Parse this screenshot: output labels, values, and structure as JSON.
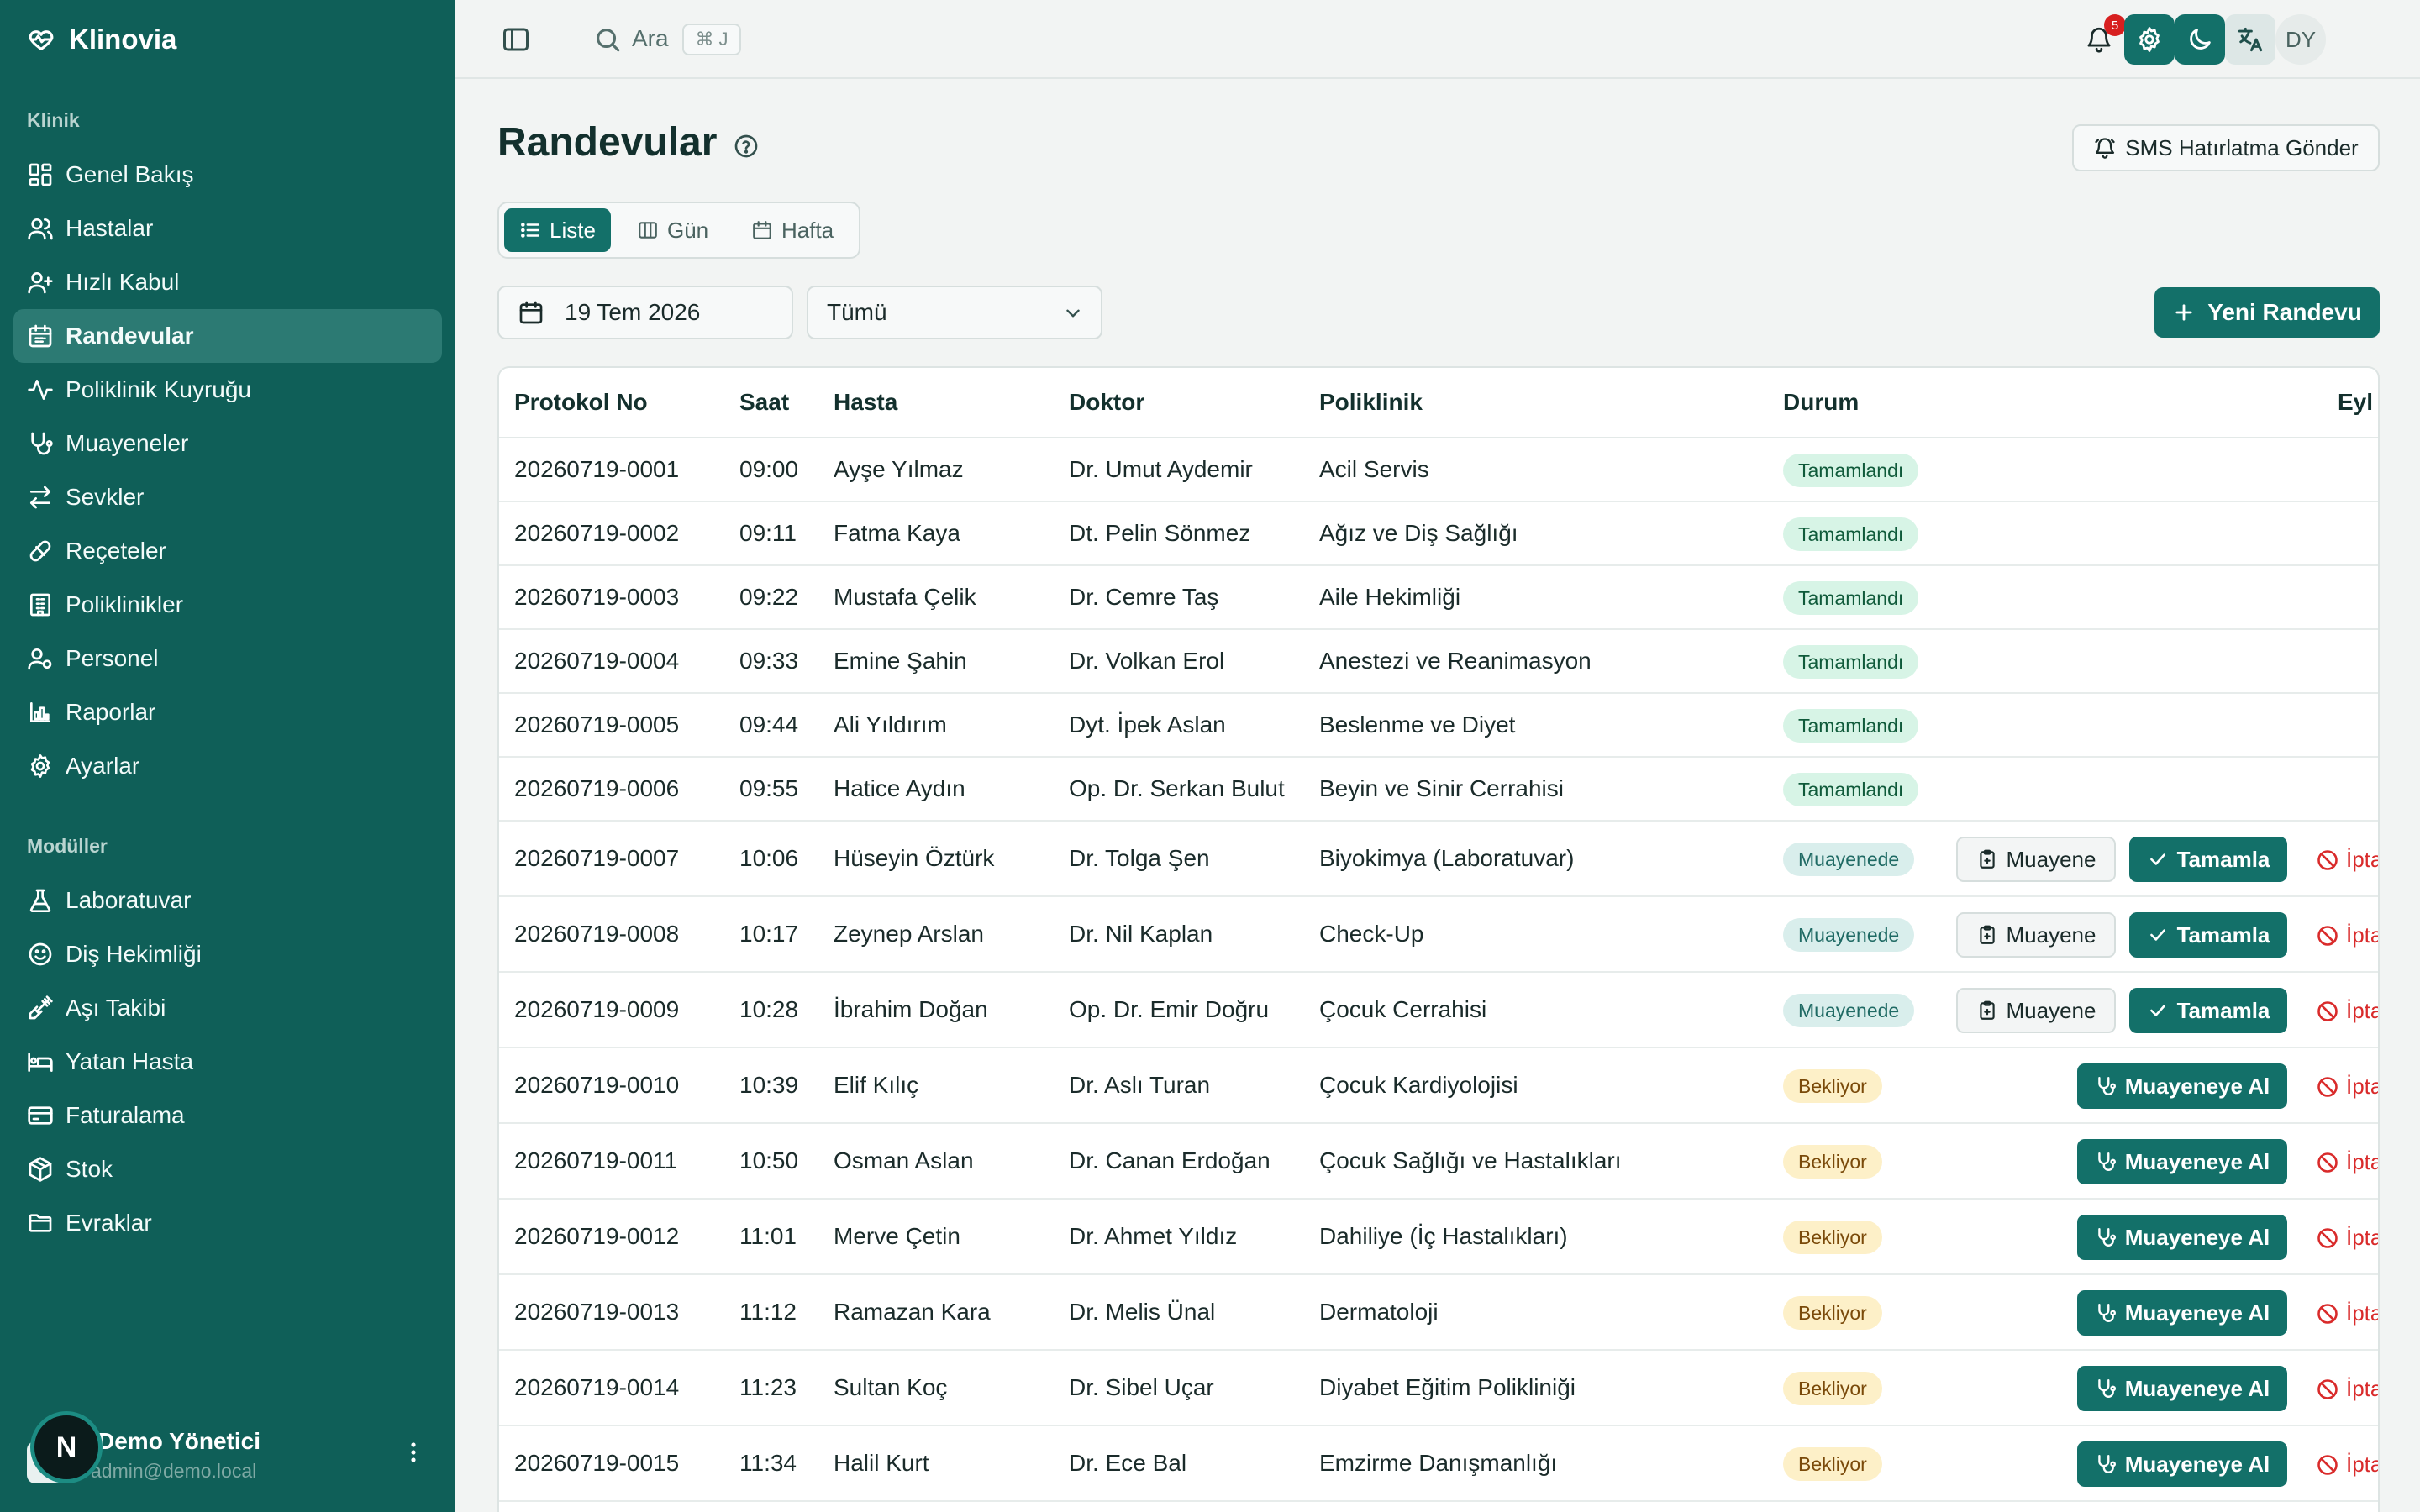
{
  "app": {
    "name": "Klinovia"
  },
  "sidebar": {
    "section1": "Klinik",
    "section2": "Modüller",
    "items": [
      {
        "label": "Genel Bakış",
        "icon": "dashboard-icon"
      },
      {
        "label": "Hastalar",
        "icon": "users-icon"
      },
      {
        "label": "Hızlı Kabul",
        "icon": "user-plus-icon"
      },
      {
        "label": "Randevular",
        "icon": "calendar-icon",
        "active": true
      },
      {
        "label": "Poliklinik Kuyruğu",
        "icon": "activity-icon"
      },
      {
        "label": "Muayeneler",
        "icon": "stethoscope-icon"
      },
      {
        "label": "Sevkler",
        "icon": "transfer-icon"
      },
      {
        "label": "Reçeteler",
        "icon": "pill-icon"
      },
      {
        "label": "Poliklinikler",
        "icon": "building-icon"
      },
      {
        "label": "Personel",
        "icon": "staff-icon"
      },
      {
        "label": "Raporlar",
        "icon": "bar-chart-icon"
      },
      {
        "label": "Ayarlar",
        "icon": "gear-icon"
      }
    ],
    "modules": [
      {
        "label": "Laboratuvar",
        "icon": "flask-icon"
      },
      {
        "label": "Diş Hekimliği",
        "icon": "smile-icon"
      },
      {
        "label": "Aşı Takibi",
        "icon": "syringe-icon"
      },
      {
        "label": "Yatan Hasta",
        "icon": "bed-icon"
      },
      {
        "label": "Faturalama",
        "icon": "credit-card-icon"
      },
      {
        "label": "Stok",
        "icon": "package-icon"
      },
      {
        "label": "Evraklar",
        "icon": "folder-icon"
      }
    ],
    "user": {
      "initial": "N",
      "name": "Demo Yönetici",
      "email": "admin@demo.local"
    }
  },
  "header": {
    "search_label": "Ara",
    "search_shortcut": "⌘ J",
    "notification_count": "5",
    "avatar_initials": "DY"
  },
  "main": {
    "title": "Randevular",
    "sms_button": "SMS Hatırlatma Gönder",
    "tabs": [
      {
        "label": "Liste",
        "active": true
      },
      {
        "label": "Gün"
      },
      {
        "label": "Hafta"
      }
    ],
    "date_value": "19 Tem 2026",
    "filter_value": "Tümü",
    "new_button": "Yeni Randevu"
  },
  "table": {
    "columns": [
      "Protokol No",
      "Saat",
      "Hasta",
      "Doktor",
      "Poliklinik",
      "Durum",
      "Eyl"
    ],
    "action_labels": {
      "examine": "Muayene",
      "complete": "Tamamla",
      "take_exam": "Muayeneye Al",
      "cancel": "İpta"
    },
    "rows": [
      {
        "protocol": "20260719-0001",
        "time": "09:00",
        "patient": "Ayşe Yılmaz",
        "doctor": "Dr. Umut Aydemir",
        "clinic": "Acil Servis",
        "status": "Tamamlandı",
        "kind": "done"
      },
      {
        "protocol": "20260719-0002",
        "time": "09:11",
        "patient": "Fatma Kaya",
        "doctor": "Dt. Pelin Sönmez",
        "clinic": "Ağız ve Diş Sağlığı",
        "status": "Tamamlandı",
        "kind": "done"
      },
      {
        "protocol": "20260719-0003",
        "time": "09:22",
        "patient": "Mustafa Çelik",
        "doctor": "Dr. Cemre Taş",
        "clinic": "Aile Hekimliği",
        "status": "Tamamlandı",
        "kind": "done"
      },
      {
        "protocol": "20260719-0004",
        "time": "09:33",
        "patient": "Emine Şahin",
        "doctor": "Dr. Volkan Erol",
        "clinic": "Anestezi ve Reanimasyon",
        "status": "Tamamlandı",
        "kind": "done"
      },
      {
        "protocol": "20260719-0005",
        "time": "09:44",
        "patient": "Ali Yıldırım",
        "doctor": "Dyt. İpek Aslan",
        "clinic": "Beslenme ve Diyet",
        "status": "Tamamlandı",
        "kind": "done"
      },
      {
        "protocol": "20260719-0006",
        "time": "09:55",
        "patient": "Hatice Aydın",
        "doctor": "Op. Dr. Serkan Bulut",
        "clinic": "Beyin ve Sinir Cerrahisi",
        "status": "Tamamlandı",
        "kind": "done"
      },
      {
        "protocol": "20260719-0007",
        "time": "10:06",
        "patient": "Hüseyin Öztürk",
        "doctor": "Dr. Tolga Şen",
        "clinic": "Biyokimya (Laboratuvar)",
        "status": "Muayenede",
        "kind": "exam"
      },
      {
        "protocol": "20260719-0008",
        "time": "10:17",
        "patient": "Zeynep Arslan",
        "doctor": "Dr. Nil Kaplan",
        "clinic": "Check-Up",
        "status": "Muayenede",
        "kind": "exam"
      },
      {
        "protocol": "20260719-0009",
        "time": "10:28",
        "patient": "İbrahim Doğan",
        "doctor": "Op. Dr. Emir Doğru",
        "clinic": "Çocuk Cerrahisi",
        "status": "Muayenede",
        "kind": "exam"
      },
      {
        "protocol": "20260719-0010",
        "time": "10:39",
        "patient": "Elif Kılıç",
        "doctor": "Dr. Aslı Turan",
        "clinic": "Çocuk Kardiyolojisi",
        "status": "Bekliyor",
        "kind": "wait"
      },
      {
        "protocol": "20260719-0011",
        "time": "10:50",
        "patient": "Osman Aslan",
        "doctor": "Dr. Canan Erdoğan",
        "clinic": "Çocuk Sağlığı ve Hastalıkları",
        "status": "Bekliyor",
        "kind": "wait"
      },
      {
        "protocol": "20260719-0012",
        "time": "11:01",
        "patient": "Merve Çetin",
        "doctor": "Dr. Ahmet Yıldız",
        "clinic": "Dahiliye (İç Hastalıkları)",
        "status": "Bekliyor",
        "kind": "wait"
      },
      {
        "protocol": "20260719-0013",
        "time": "11:12",
        "patient": "Ramazan Kara",
        "doctor": "Dr. Melis Ünal",
        "clinic": "Dermatoloji",
        "status": "Bekliyor",
        "kind": "wait"
      },
      {
        "protocol": "20260719-0014",
        "time": "11:23",
        "patient": "Sultan Koç",
        "doctor": "Dr. Sibel Uçar",
        "clinic": "Diyabet Eğitim Polikliniği",
        "status": "Bekliyor",
        "kind": "wait"
      },
      {
        "protocol": "20260719-0015",
        "time": "11:34",
        "patient": "Halil Kurt",
        "doctor": "Dr. Ece Bal",
        "clinic": "Emzirme Danışmanlığı",
        "status": "Bekliyor",
        "kind": "wait"
      }
    ]
  },
  "colors": {
    "primary": "#137069",
    "sidebar": "#0f5f58",
    "danger": "#d92b2b"
  }
}
